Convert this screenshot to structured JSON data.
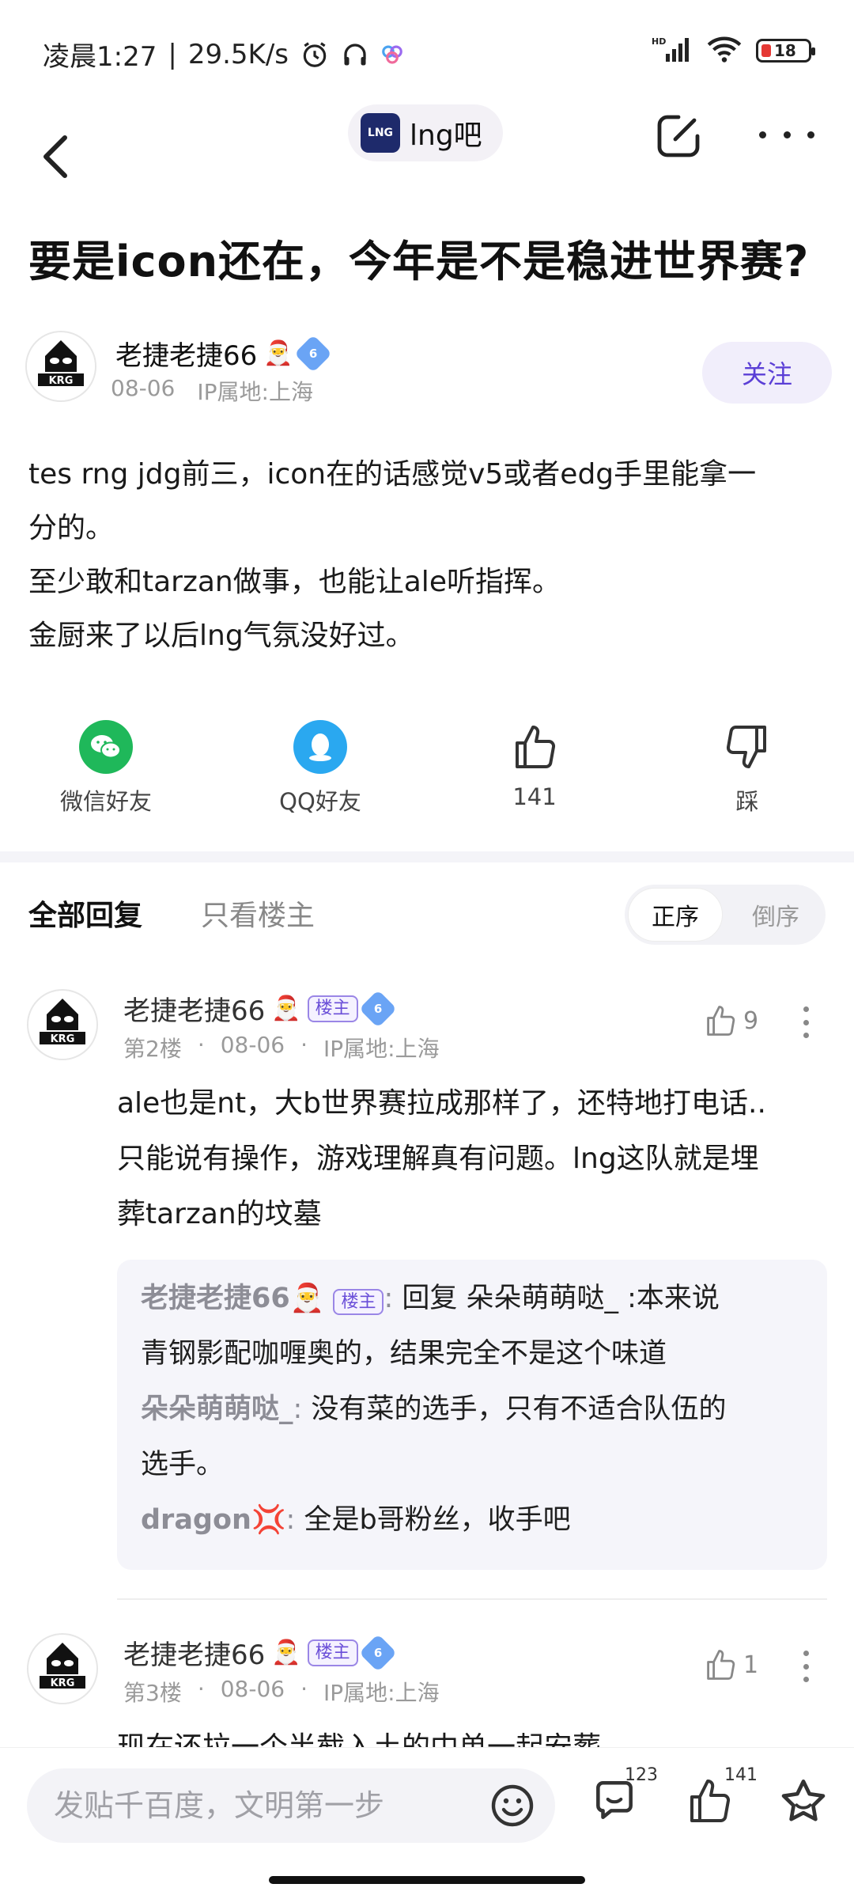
{
  "status_bar": {
    "time": "凌晨1:27",
    "net_speed": "29.5K/s",
    "battery": "18",
    "icons": [
      "alarm-icon",
      "headphones-icon",
      "app-notification-icon",
      "hd-signal-icon",
      "wifi-icon",
      "battery-icon"
    ]
  },
  "nav": {
    "forum_name": "lng吧"
  },
  "post": {
    "title": "要是icon还在，今年是不是稳进世界赛?",
    "author": "老捷老捷66",
    "author_emoji": "🎅",
    "level": "6",
    "date": "08-06",
    "ip": "IP属地:上海",
    "follow_label": "关注",
    "body": [
      "tes rng jdg前三，icon在的话感觉v5或者edg手里能拿一",
      "分的。",
      "至少敢和tarzan做事，也能让ale听指挥。",
      "金厨来了以后lng气氛没好过。"
    ]
  },
  "actions": {
    "wechat_label": "微信好友",
    "qq_label": "QQ好友",
    "like_count": "141",
    "dislike_label": "踩"
  },
  "replies_header": {
    "tab_all": "全部回复",
    "tab_owner_only": "只看楼主",
    "sort_asc": "正序",
    "sort_desc": "倒序"
  },
  "replies": [
    {
      "name": "老捷老捷66",
      "emoji": "🎅",
      "owner_tag": "楼主",
      "level": "6",
      "floor": "第2楼",
      "date": "08-06",
      "ip": "IP属地:上海",
      "likes": "9",
      "content": [
        "ale也是nt，大b世界赛拉成那样了，还特地打电话..",
        "只能说有操作，游戏理解真有问题。lng这队就是埋",
        "葬tarzan的坟墓"
      ],
      "sub_replies": [
        {
          "name": "老捷老捷66🎅",
          "tag": "楼主",
          "text_line1": "回复 朵朵萌萌哒_ :本来说",
          "text_line2": "青钢影配咖喱奥的，结果完全不是这个味道"
        },
        {
          "name": "朵朵萌萌哒_",
          "text_line1": "没有菜的选手，只有不适合队伍的",
          "text_line2": "选手。"
        },
        {
          "name": "dragon💢",
          "text_line1": "全是b哥粉丝，收手吧"
        }
      ]
    },
    {
      "name": "老捷老捷66",
      "emoji": "🎅",
      "owner_tag": "楼主",
      "level": "6",
      "floor": "第3楼",
      "date": "08-06",
      "ip": "IP属地:上海",
      "likes": "1",
      "content_partial": "现在还拉一个半截入土的中单一起安葬"
    }
  ],
  "bottom_bar": {
    "input_placeholder": "发贴千百度，文明第一步",
    "comment_count": "123",
    "like_count": "141"
  },
  "colors": {
    "accent_purple": "#5b3fd6",
    "wechat_green": "#1fb85a",
    "qq_blue": "#2aa8f0",
    "battery_red": "#e53935"
  }
}
